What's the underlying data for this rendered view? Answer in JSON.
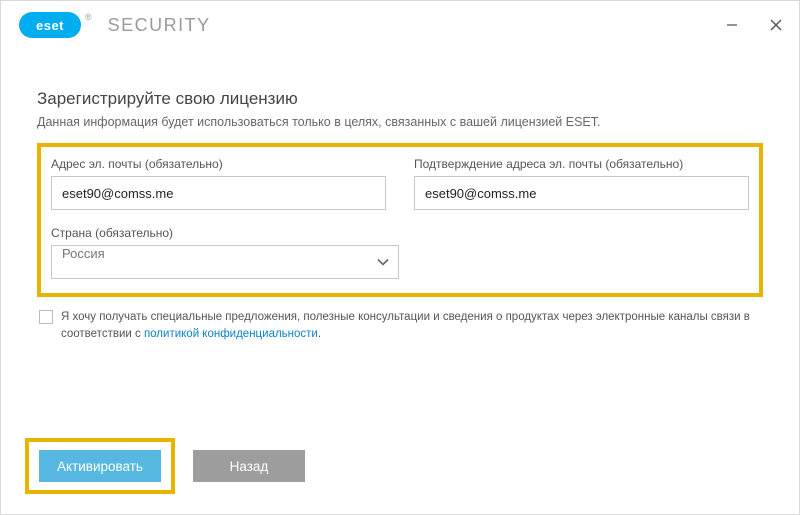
{
  "titlebar": {
    "brand_mark": "eset",
    "brand_text": "SECURITY",
    "reg": "®"
  },
  "page": {
    "heading": "Зарегистрируйте свою лицензию",
    "subheading": "Данная информация будет использоваться только в целях, связанных с вашей лицензией ESET."
  },
  "form": {
    "email": {
      "label": "Адрес эл. почты (обязательно)",
      "value": "eset90@comss.me"
    },
    "email_confirm": {
      "label": "Подтверждение адреса эл. почты (обязательно)",
      "value": "eset90@comss.me"
    },
    "country": {
      "label": "Страна (обязательно)",
      "value": "Россия"
    }
  },
  "consent": {
    "text_prefix": "Я хочу получать специальные предложения, полезные консультации и сведения о продуктах через электронные каналы связи в соответствии с ",
    "link_text": "политикой конфиденциальности",
    "text_suffix": "."
  },
  "buttons": {
    "activate": "Активировать",
    "back": "Назад"
  }
}
